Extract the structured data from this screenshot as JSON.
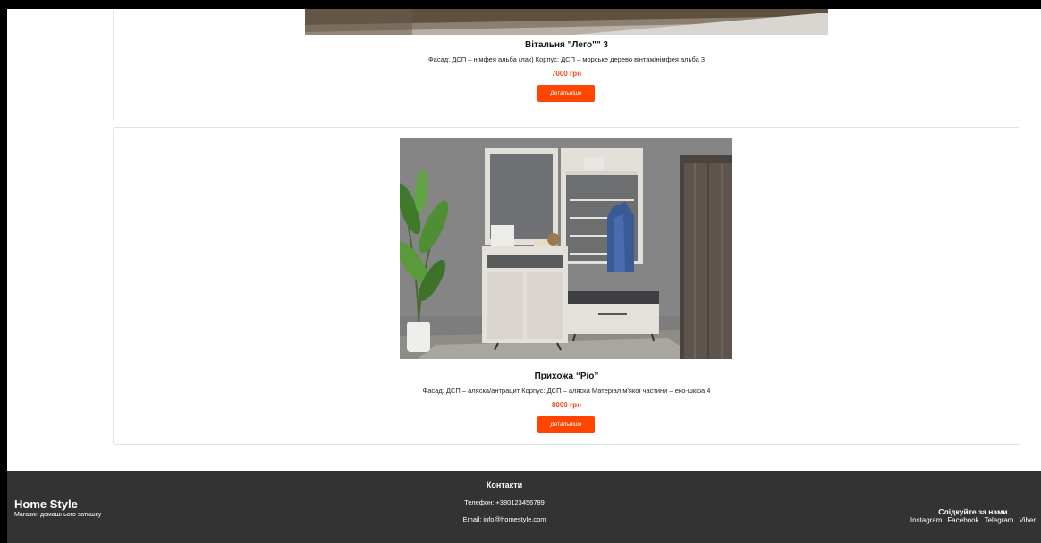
{
  "products": [
    {
      "title": "Вітальня \"Лего\"\" 3",
      "description": "Фасад: ДСП – німфея альба (лак) Корпус: ДСП – морське дерево вінтаж/німфея альба 3",
      "price": "7000 грн",
      "button_label": "Детальніше"
    },
    {
      "title": "Прихожа “Ріо”",
      "description": "Фасад: ДСП – аляска/антрацит Корпус: ДСП – аляска Матеріал м'якої частини – еко-шкіра 4",
      "price": "8000 грн",
      "button_label": "Детальніше"
    }
  ],
  "footer": {
    "brand": "Home Style",
    "tagline": "Магазин домашнього затишку",
    "contacts_title": "Контакти",
    "phone": "Телефон: +380123456789",
    "email": "Email: info@homestyle.com",
    "social_title": "Слідкуйте за нами",
    "social_links": [
      "Instagram",
      "Facebook",
      "Telegram",
      "Viber"
    ]
  },
  "colors": {
    "accent": "#ff4500",
    "price": "#f04a17",
    "footer_bg": "#333333"
  }
}
